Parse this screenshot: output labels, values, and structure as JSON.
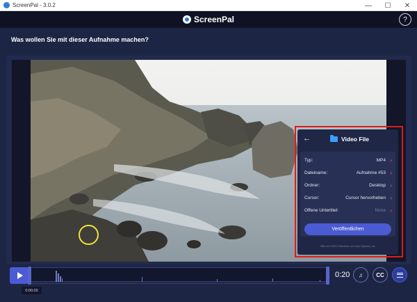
{
  "window": {
    "title": "ScreenPal - 3.0.2",
    "minimize": "—",
    "maximize": "☐",
    "close": "✕"
  },
  "header": {
    "logo_text": "ScreenPal",
    "help_label": "?"
  },
  "prompt": {
    "question": "Was wollen Sie mit dieser Aufnahme machen?"
  },
  "panel": {
    "back_icon": "←",
    "title": "Video File",
    "rows": [
      {
        "label": "Typ:",
        "value": "MP4"
      },
      {
        "label": "Dateiname:",
        "value": "Aufnahme #53"
      },
      {
        "label": "Ordner:",
        "value": "Desktop"
      },
      {
        "label": "Cursor:",
        "value": "Cursor hervorheben"
      },
      {
        "label": "Offene Untertitel:",
        "value": "None"
      }
    ],
    "chevron": "›",
    "publish_label": "Veröffentlichen",
    "footer_note": "Offen ist ©2024 Videotools von Cisco Systems, Inc."
  },
  "controls": {
    "timecode": "0:00.00",
    "duration": "0:20",
    "music_icon": "♫",
    "cc_label": "CC"
  },
  "colors": {
    "accent": "#4b5bd3",
    "highlight_border": "#e01b1b",
    "cursor_ring": "#f2e23a",
    "chevron": "#e0457a"
  }
}
